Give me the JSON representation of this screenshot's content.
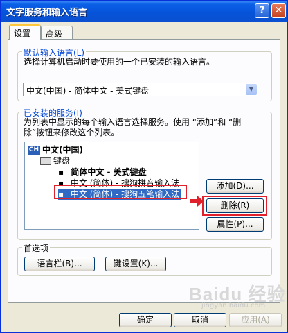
{
  "window": {
    "title": "文字服务和输入语言"
  },
  "titlebar": {
    "help": "?",
    "close": "✕"
  },
  "tabs": [
    {
      "label": "设置"
    },
    {
      "label": "高级"
    }
  ],
  "default_lang": {
    "legend": "默认输入语言(L)",
    "description": "选择计算机启动时要使用的一个已安装的输入语言。",
    "selected": "中文(中国) - 简体中文 - 美式键盘"
  },
  "services": {
    "legend": "已安装的服务(I)",
    "description_line1": "为列表中显示的每个输入语言选择服务。使用 “添加”和 “删",
    "description_line2": "除”按钮来修改这个列表。",
    "language": "中文(中国)",
    "language_badge": "CH",
    "category": "键盘",
    "items": [
      {
        "label": "简体中文 - 美式键盘"
      },
      {
        "label": "中文 (简体) - 搜狗拼音输入法"
      },
      {
        "label": "中文 (简体) - 搜狗五笔输入法"
      }
    ],
    "buttons": {
      "add": "添加(D)...",
      "remove": "删除(R)",
      "properties": "属性(P)..."
    }
  },
  "preferences": {
    "legend": "首选项",
    "language_bar": "语言栏(B)...",
    "key_settings": "键设置(K)..."
  },
  "footer": {
    "ok": "确定",
    "cancel": "取消",
    "apply": "应用(A)"
  },
  "watermark": "Baidu 经验",
  "watermark_url": "jingyan.baidu.com",
  "colors": {
    "annotation_red": "#e0202a",
    "selection_blue": "#316ac5"
  }
}
